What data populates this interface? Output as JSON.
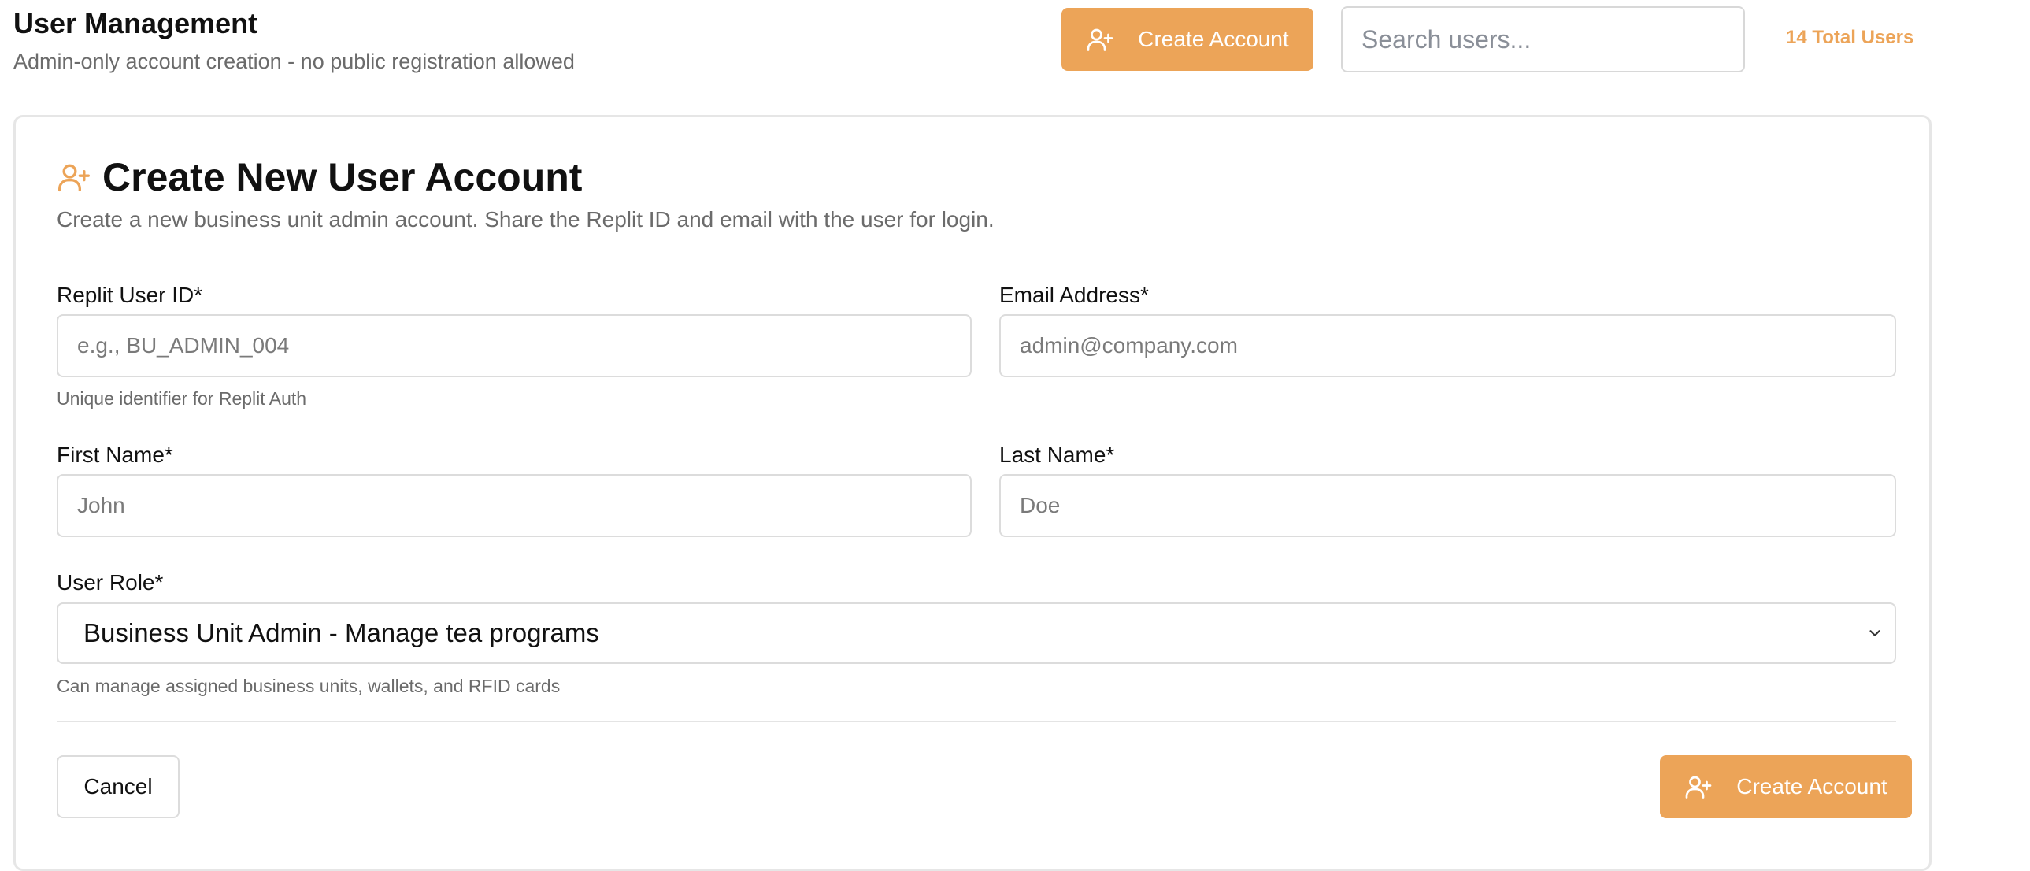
{
  "header": {
    "title": "User Management",
    "subtitle": "Admin-only account creation - no public registration allowed",
    "create_button_label": "Create Account",
    "search_placeholder": "Search users...",
    "total_users": "14 Total Users"
  },
  "form": {
    "title": "Create New User Account",
    "description": "Create a new business unit admin account. Share the Replit ID and email with the user for login.",
    "replit_id": {
      "label": "Replit User ID*",
      "placeholder": "e.g., BU_ADMIN_004",
      "help": "Unique identifier for Replit Auth"
    },
    "email": {
      "label": "Email Address*",
      "placeholder": "admin@company.com"
    },
    "first_name": {
      "label": "First Name*",
      "placeholder": "John"
    },
    "last_name": {
      "label": "Last Name*",
      "placeholder": "Doe"
    },
    "role": {
      "label": "User Role*",
      "selected": "Business Unit Admin - Manage tea programs",
      "help": "Can manage assigned business units, wallets, and RFID cards"
    },
    "cancel_label": "Cancel",
    "submit_label": "Create Account"
  },
  "colors": {
    "accent": "#eca458",
    "muted_text": "#6b6b6b",
    "border": "#dcdcdc"
  },
  "icons": {
    "create": "user-plus-icon",
    "select": "chevron-down-icon"
  }
}
